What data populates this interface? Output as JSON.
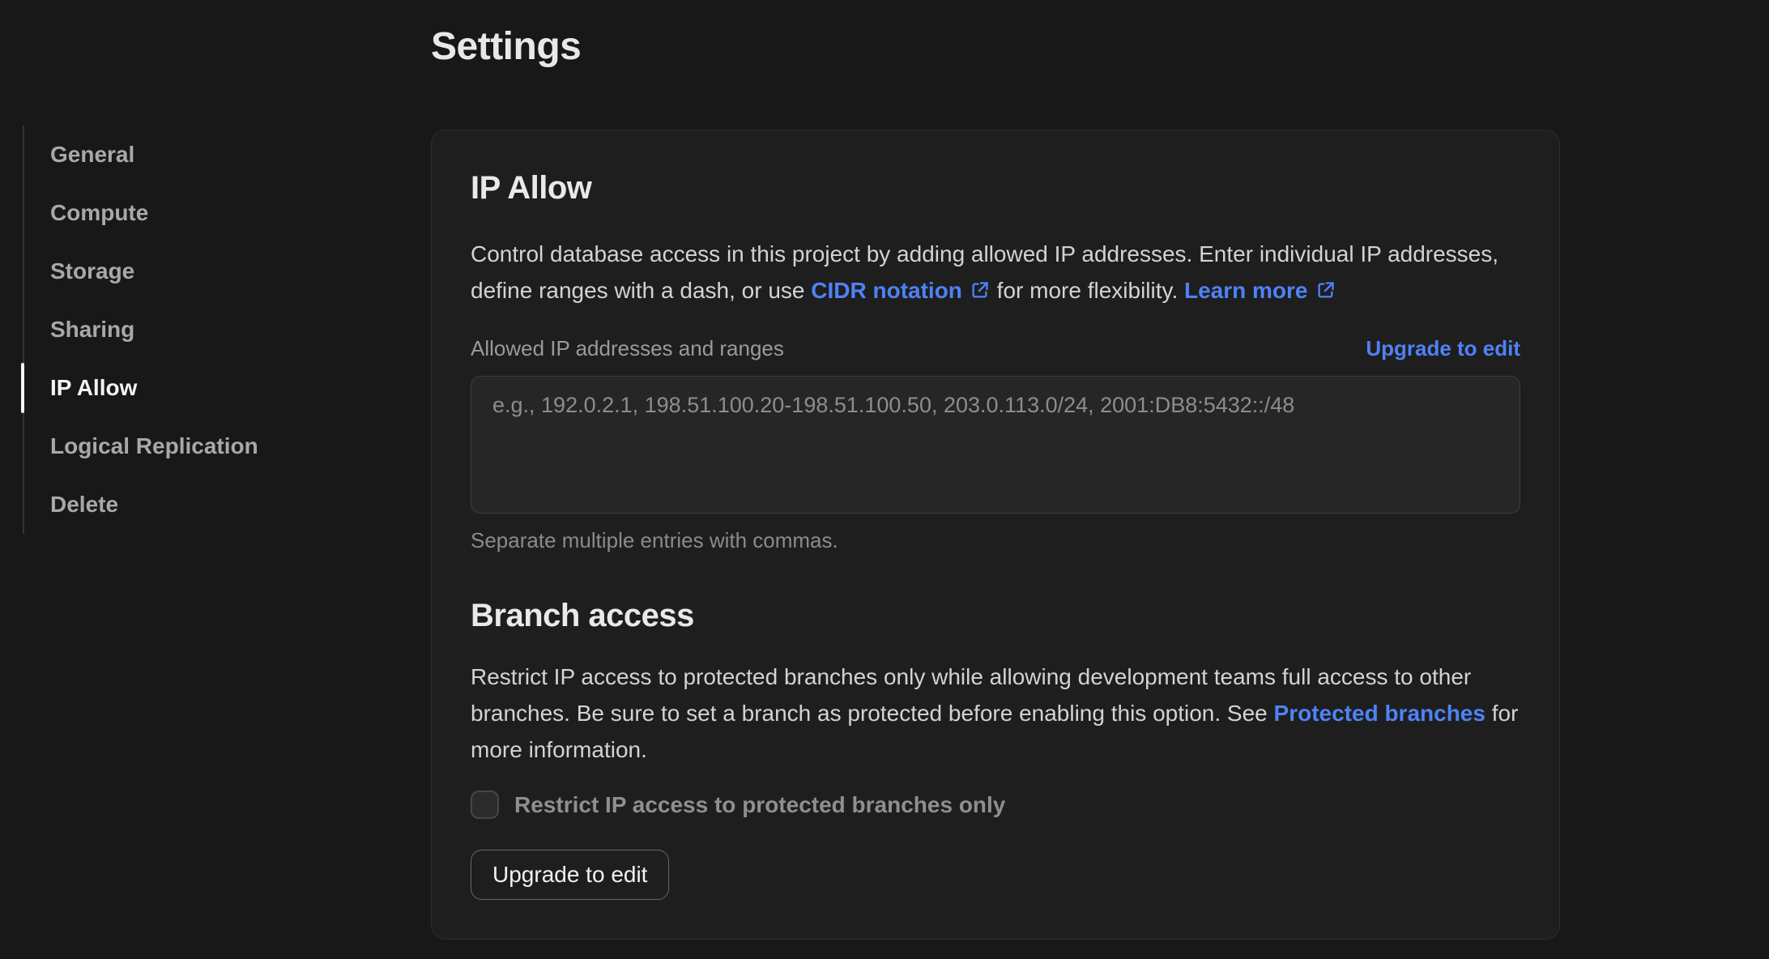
{
  "page": {
    "title": "Settings"
  },
  "sidebar": {
    "items": [
      {
        "label": "General",
        "active": false
      },
      {
        "label": "Compute",
        "active": false
      },
      {
        "label": "Storage",
        "active": false
      },
      {
        "label": "Sharing",
        "active": false
      },
      {
        "label": "IP Allow",
        "active": true
      },
      {
        "label": "Logical Replication",
        "active": false
      },
      {
        "label": "Delete",
        "active": false
      }
    ]
  },
  "ip_allow": {
    "heading": "IP Allow",
    "desc_before_cidr": "Control database access in this project by adding allowed IP addresses. Enter individual IP addresses, define ranges with a dash, or use ",
    "cidr_link_label": "CIDR notation",
    "desc_after_cidr": " for more flexibility. ",
    "learn_more_label": "Learn more",
    "field_label": "Allowed IP addresses and ranges",
    "upgrade_link_label": "Upgrade to edit",
    "textarea_placeholder": "e.g., 192.0.2.1, 198.51.100.20-198.51.100.50, 203.0.113.0/24, 2001:DB8:5432::/48",
    "textarea_value": "",
    "hint": "Separate multiple entries with commas."
  },
  "branch_access": {
    "heading": "Branch access",
    "desc_before_link": "Restrict IP access to protected branches only while allowing development teams full access to other branches. Be sure to set a branch as protected before enabling this option. See ",
    "protected_link_label": "Protected branches",
    "desc_after_link": " for more information.",
    "checkbox_label": "Restrict IP access to protected branches only",
    "checkbox_checked": false,
    "button_label": "Upgrade to edit"
  },
  "icons": {
    "external_link": "arrow-up-right-from-square"
  },
  "colors": {
    "page_bg": "#181818",
    "card_bg": "#1e1e1e",
    "card_border": "#2d2d2d",
    "link_blue": "#4e82f6",
    "active_indicator": "#f6f6f6"
  }
}
